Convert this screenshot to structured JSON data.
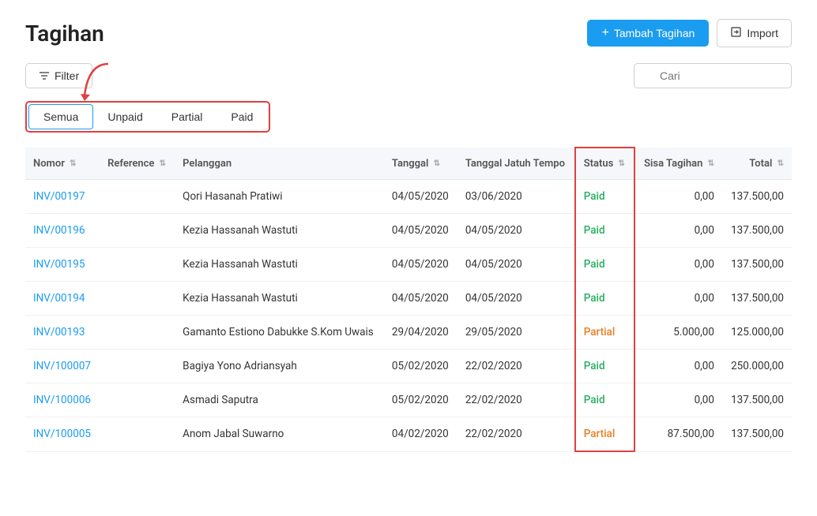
{
  "page": {
    "title": "Tagihan"
  },
  "header": {
    "tambah_label": "+ Tambah Tagihan",
    "import_label": "Import"
  },
  "toolbar": {
    "filter_label": "Filter",
    "search_placeholder": "Cari"
  },
  "tabs": [
    {
      "id": "semua",
      "label": "Semua",
      "active": true
    },
    {
      "id": "unpaid",
      "label": "Unpaid",
      "active": false
    },
    {
      "id": "partial",
      "label": "Partial",
      "active": false
    },
    {
      "id": "paid",
      "label": "Paid",
      "active": false
    }
  ],
  "table": {
    "columns": [
      {
        "id": "nomor",
        "label": "Nomor"
      },
      {
        "id": "reference",
        "label": "Reference"
      },
      {
        "id": "pelanggan",
        "label": "Pelanggan"
      },
      {
        "id": "tanggal",
        "label": "Tanggal"
      },
      {
        "id": "tanggal_jatuh_tempo",
        "label": "Tanggal Jatuh Tempo"
      },
      {
        "id": "status",
        "label": "Status"
      },
      {
        "id": "sisa_tagihan",
        "label": "Sisa Tagihan"
      },
      {
        "id": "total",
        "label": "Total"
      }
    ],
    "rows": [
      {
        "nomor": "INV/00197",
        "reference": "",
        "pelanggan": "Qori Hasanah Pratiwi",
        "tanggal": "04/05/2020",
        "tanggal_jatuh_tempo": "03/06/2020",
        "status": "Paid",
        "sisa_tagihan": "0,00",
        "total": "137.500,00"
      },
      {
        "nomor": "INV/00196",
        "reference": "",
        "pelanggan": "Kezia Hassanah Wastuti",
        "tanggal": "04/05/2020",
        "tanggal_jatuh_tempo": "04/05/2020",
        "status": "Paid",
        "sisa_tagihan": "0,00",
        "total": "137.500,00"
      },
      {
        "nomor": "INV/00195",
        "reference": "",
        "pelanggan": "Kezia Hassanah Wastuti",
        "tanggal": "04/05/2020",
        "tanggal_jatuh_tempo": "04/05/2020",
        "status": "Paid",
        "sisa_tagihan": "0,00",
        "total": "137.500,00"
      },
      {
        "nomor": "INV/00194",
        "reference": "",
        "pelanggan": "Kezia Hassanah Wastuti",
        "tanggal": "04/05/2020",
        "tanggal_jatuh_tempo": "04/05/2020",
        "status": "Paid",
        "sisa_tagihan": "0,00",
        "total": "137.500,00"
      },
      {
        "nomor": "INV/00193",
        "reference": "",
        "pelanggan": "Gamanto Estiono Dabukke S.Kom Uwais",
        "tanggal": "29/04/2020",
        "tanggal_jatuh_tempo": "29/05/2020",
        "status": "Partial",
        "sisa_tagihan": "5.000,00",
        "total": "125.000,00"
      },
      {
        "nomor": "INV/100007",
        "reference": "",
        "pelanggan": "Bagiya Yono Adriansyah",
        "tanggal": "05/02/2020",
        "tanggal_jatuh_tempo": "22/02/2020",
        "status": "Paid",
        "sisa_tagihan": "0,00",
        "total": "250.000,00"
      },
      {
        "nomor": "INV/100006",
        "reference": "",
        "pelanggan": "Asmadi Saputra",
        "tanggal": "05/02/2020",
        "tanggal_jatuh_tempo": "22/02/2020",
        "status": "Paid",
        "sisa_tagihan": "0,00",
        "total": "137.500,00"
      },
      {
        "nomor": "INV/100005",
        "reference": "",
        "pelanggan": "Anom Jabal Suwarno",
        "tanggal": "04/02/2020",
        "tanggal_jatuh_tempo": "22/02/2020",
        "status": "Partial",
        "sisa_tagihan": "87.500,00",
        "total": "137.500,00"
      }
    ]
  }
}
